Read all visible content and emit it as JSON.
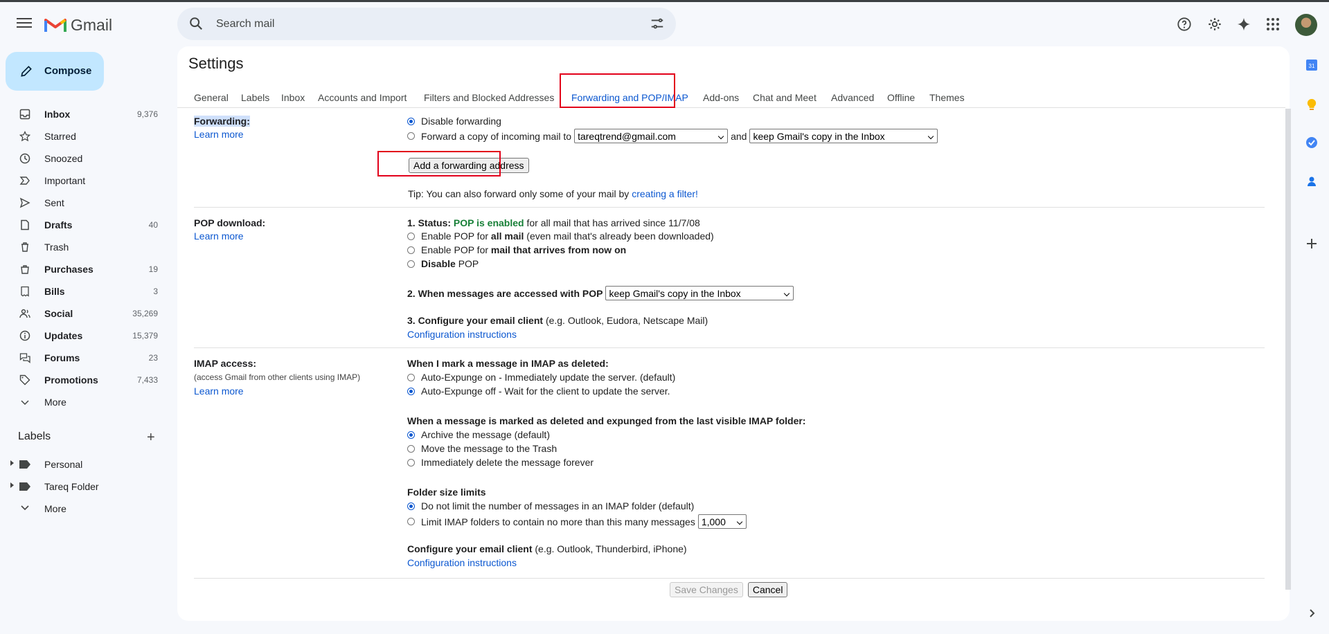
{
  "app": {
    "name": "Gmail"
  },
  "search": {
    "placeholder": "Search mail"
  },
  "compose": {
    "label": "Compose"
  },
  "nav": [
    {
      "label": "Inbox",
      "count": "9,376",
      "bold": true,
      "icon": "inbox-icon"
    },
    {
      "label": "Starred",
      "count": "",
      "bold": false,
      "icon": "star-icon"
    },
    {
      "label": "Snoozed",
      "count": "",
      "bold": false,
      "icon": "clock-icon"
    },
    {
      "label": "Important",
      "count": "",
      "bold": false,
      "icon": "important-icon"
    },
    {
      "label": "Sent",
      "count": "",
      "bold": false,
      "icon": "send-icon"
    },
    {
      "label": "Drafts",
      "count": "40",
      "bold": true,
      "icon": "draft-icon"
    },
    {
      "label": "Trash",
      "count": "",
      "bold": false,
      "icon": "trash-icon"
    },
    {
      "label": "Purchases",
      "count": "19",
      "bold": true,
      "icon": "purchases-icon"
    },
    {
      "label": "Bills",
      "count": "3",
      "bold": true,
      "icon": "bills-icon"
    },
    {
      "label": "Social",
      "count": "35,269",
      "bold": true,
      "icon": "people-icon"
    },
    {
      "label": "Updates",
      "count": "15,379",
      "bold": true,
      "icon": "info-icon"
    },
    {
      "label": "Forums",
      "count": "23",
      "bold": true,
      "icon": "forum-icon"
    },
    {
      "label": "Promotions",
      "count": "7,433",
      "bold": true,
      "icon": "tag-icon"
    },
    {
      "label": "More",
      "count": "",
      "bold": false,
      "icon": "chevron-down-icon"
    }
  ],
  "labels": {
    "heading": "Labels",
    "items": [
      "Personal",
      "Tareq Folder"
    ],
    "more": "More"
  },
  "settings": {
    "title": "Settings",
    "tabs": [
      "General",
      "Labels",
      "Inbox",
      "Accounts and Import",
      "Filters and Blocked Addresses",
      "Forwarding and POP/IMAP",
      "Add-ons",
      "Chat and Meet",
      "Advanced",
      "Offline",
      "Themes"
    ],
    "active_tab": "Forwarding and POP/IMAP",
    "forwarding": {
      "label": "Forwarding:",
      "learn_more": "Learn more",
      "disable": "Disable forwarding",
      "forward_copy": "Forward a copy of incoming mail to",
      "address": "tareqtrend@gmail.com",
      "and": "and",
      "action": "keep Gmail's copy in the Inbox",
      "add_button": "Add a forwarding address",
      "tip": "Tip: You can also forward only some of your mail by",
      "tip_link": "creating a filter!"
    },
    "pop": {
      "label": "POP download:",
      "learn_more": "Learn more",
      "status_prefix": "1. Status:",
      "status_value": "POP is enabled",
      "status_suffix": "for all mail that has arrived since 11/7/08",
      "opt1_a": "Enable POP for",
      "opt1_b": "all mail",
      "opt1_c": "(even mail that's already been downloaded)",
      "opt2_a": "Enable POP for",
      "opt2_b": "mail that arrives from now on",
      "opt3_a": "Disable",
      "opt3_b": "POP",
      "when_accessed": "2. When messages are accessed with POP",
      "when_value": "keep Gmail's copy in the Inbox",
      "configure": "3. Configure your email client",
      "configure_eg": "(e.g. Outlook, Eudora, Netscape Mail)",
      "config_link": "Configuration instructions"
    },
    "imap": {
      "label": "IMAP access:",
      "sublabel": "(access Gmail from other clients using IMAP)",
      "learn_more": "Learn more",
      "deleted_head": "When I mark a message in IMAP as deleted:",
      "auto_on": "Auto-Expunge on - Immediately update the server. (default)",
      "auto_off": "Auto-Expunge off - Wait for the client to update the server.",
      "expunged_head": "When a message is marked as deleted and expunged from the last visible IMAP folder:",
      "archive": "Archive the message (default)",
      "move_trash": "Move the message to the Trash",
      "delete_forever": "Immediately delete the message forever",
      "folder_head": "Folder size limits",
      "no_limit": "Do not limit the number of messages in an IMAP folder (default)",
      "limit": "Limit IMAP folders to contain no more than this many messages",
      "limit_value": "1,000",
      "configure": "Configure your email client",
      "configure_eg": "(e.g. Outlook, Thunderbird, iPhone)",
      "config_link": "Configuration instructions"
    },
    "save": "Save Changes",
    "cancel": "Cancel"
  },
  "colors": {
    "accent": "#0b57d0",
    "compose": "#c2e7ff",
    "highlight": "#e2001a",
    "pop_enabled": "#188038"
  }
}
